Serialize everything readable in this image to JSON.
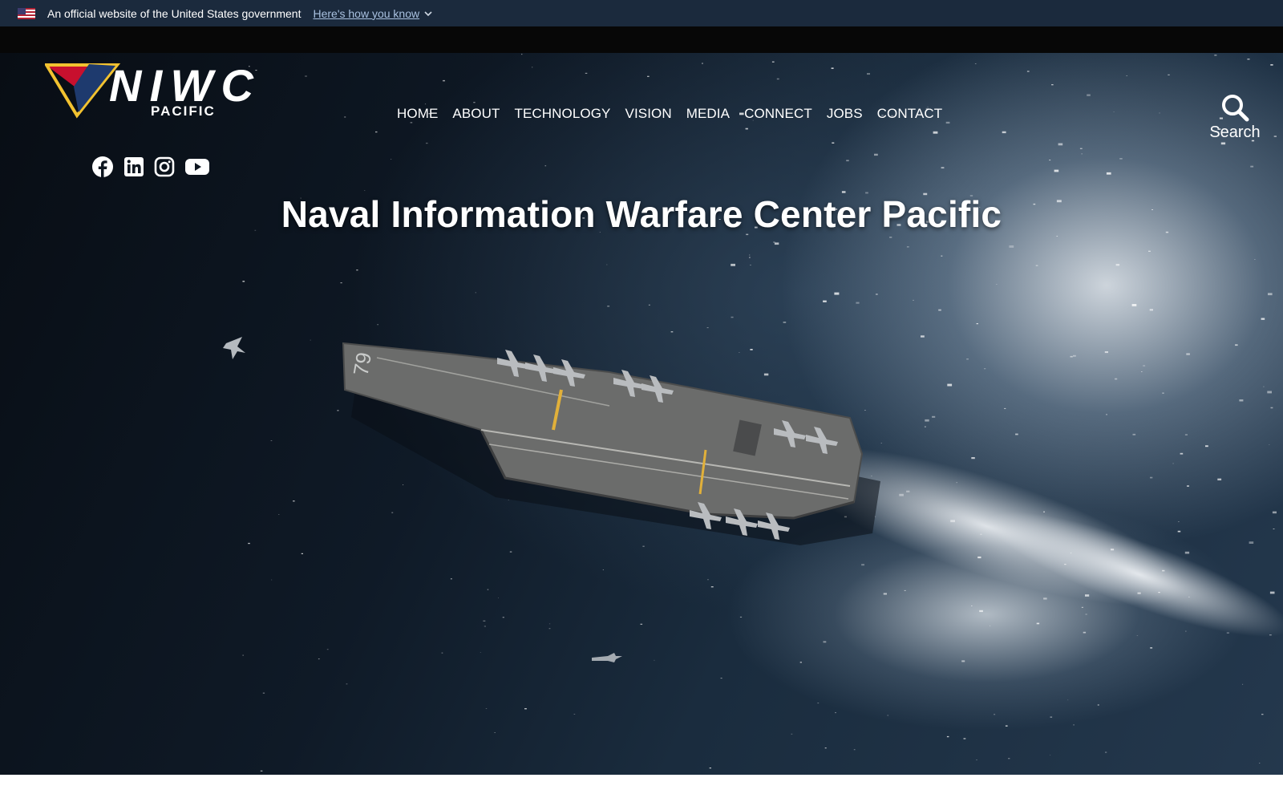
{
  "gov_banner": {
    "text": "An official website of the United States government",
    "link": "Here's how you know"
  },
  "logo": {
    "wordmark": "NIWC",
    "subtitle": "PACIFIC",
    "colors": {
      "red": "#c8102e",
      "navy": "#1e3a6e",
      "gold": "#f2c230"
    }
  },
  "nav": {
    "items": [
      "HOME",
      "ABOUT",
      "TECHNOLOGY",
      "VISION",
      "MEDIA",
      "CONNECT",
      "JOBS",
      "CONTACT"
    ]
  },
  "search": {
    "label": "Search",
    "icon": "search-icon"
  },
  "social": {
    "icons": [
      "facebook-icon",
      "linkedin-icon",
      "instagram-icon",
      "youtube-icon"
    ]
  },
  "hero": {
    "title": "Naval Information Warfare Center Pacific",
    "ship_hull_number": "79"
  }
}
